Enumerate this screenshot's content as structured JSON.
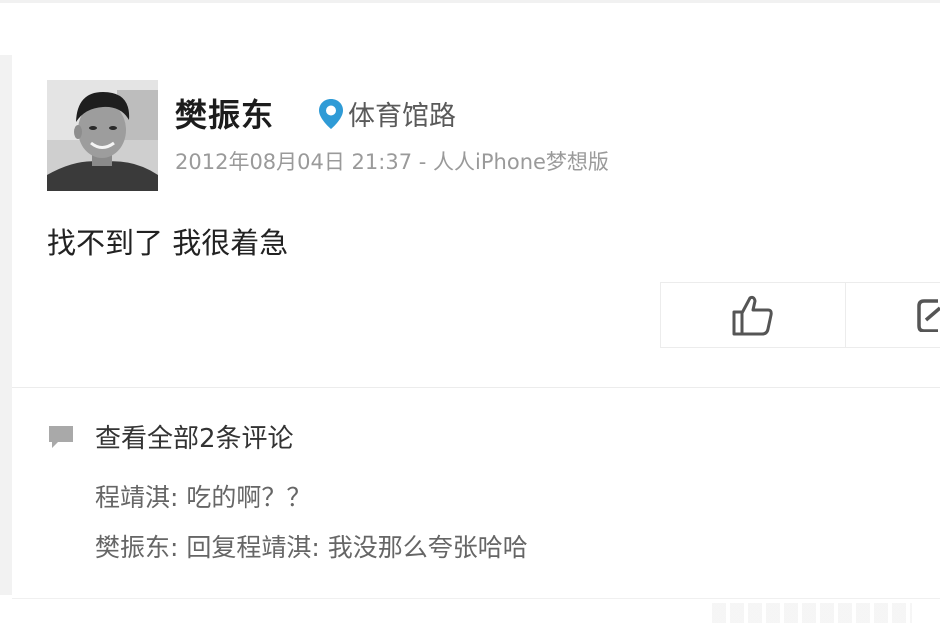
{
  "post": {
    "username": "樊振东",
    "location": "体育馆路",
    "date": "2012年08月04日 21:37",
    "separator": "-",
    "source": "人人iPhone梦想版",
    "text": "找不到了 我很着急"
  },
  "comments": {
    "header": "查看全部2条评论",
    "items": [
      {
        "author": "程靖淇",
        "sep": ": ",
        "text": "吃的啊？？"
      },
      {
        "author": "樊振东",
        "sep": ": ",
        "text": "回复程靖淇: 我没那么夸张哈哈"
      }
    ]
  },
  "icons": {
    "location": "location-pin-icon",
    "like": "thumbs-up-icon",
    "share": "share-icon",
    "comment": "comment-bubble-icon"
  },
  "colors": {
    "accent": "#2f9bd6",
    "text_primary": "#1c1c1c",
    "text_meta": "#9a9a9a",
    "text_comment": "#666666"
  }
}
